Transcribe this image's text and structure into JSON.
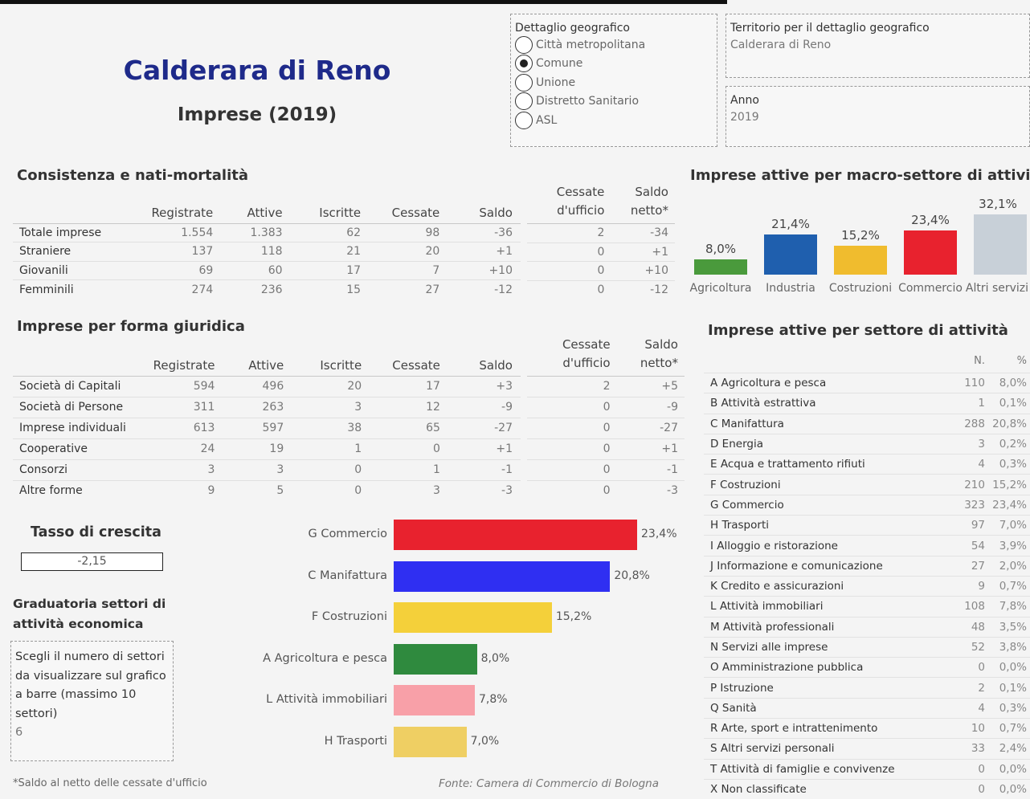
{
  "header": {
    "title": "Calderara di Reno",
    "subtitle": "Imprese  (2019)"
  },
  "geo_filter": {
    "label": "Dettaglio geografico",
    "options": [
      {
        "label": "Città metropolitana",
        "selected": false
      },
      {
        "label": "Comune",
        "selected": true
      },
      {
        "label": "Unione",
        "selected": false
      },
      {
        "label": "Distretto Sanitario",
        "selected": false
      },
      {
        "label": "ASL",
        "selected": false
      }
    ]
  },
  "territorio": {
    "label": "Territorio per il dettaglio geografico",
    "value": "Calderara di Reno"
  },
  "anno": {
    "label": "Anno",
    "value": "2019"
  },
  "consistenza": {
    "title": "Consistenza e nati-mortalità",
    "columns": [
      "",
      "Registrate",
      "Attive",
      "Iscritte",
      "Cessate",
      "Saldo"
    ],
    "rows": [
      [
        "Totale imprese",
        "1.554",
        "1.383",
        "62",
        "98",
        "-36"
      ],
      [
        "Straniere",
        "137",
        "118",
        "21",
        "20",
        "+1"
      ],
      [
        "Giovanili",
        "69",
        "60",
        "17",
        "7",
        "+10"
      ],
      [
        "Femminili",
        "274",
        "236",
        "15",
        "27",
        "-12"
      ]
    ],
    "extra_columns": [
      "Cessate d'ufficio",
      "Saldo netto*"
    ],
    "extra_rows": [
      [
        "2",
        "-34"
      ],
      [
        "0",
        "+1"
      ],
      [
        "0",
        "+10"
      ],
      [
        "0",
        "-12"
      ]
    ]
  },
  "forma": {
    "title": "Imprese per forma giuridica",
    "columns": [
      "",
      "Registrate",
      "Attive",
      "Iscritte",
      "Cessate",
      "Saldo"
    ],
    "rows": [
      [
        "Società di Capitali",
        "594",
        "496",
        "20",
        "17",
        "+3"
      ],
      [
        "Società di Persone",
        "311",
        "263",
        "3",
        "12",
        "-9"
      ],
      [
        "Imprese individuali",
        "613",
        "597",
        "38",
        "65",
        "-27"
      ],
      [
        "Cooperative",
        "24",
        "19",
        "1",
        "0",
        "+1"
      ],
      [
        "Consorzi",
        "3",
        "3",
        "0",
        "1",
        "-1"
      ],
      [
        "Altre forme",
        "9",
        "5",
        "0",
        "3",
        "-3"
      ]
    ],
    "extra_columns": [
      "Cessate d'ufficio",
      "Saldo netto*"
    ],
    "extra_rows": [
      [
        "2",
        "+5"
      ],
      [
        "0",
        "-9"
      ],
      [
        "0",
        "-27"
      ],
      [
        "0",
        "+1"
      ],
      [
        "0",
        "-1"
      ],
      [
        "0",
        "-3"
      ]
    ]
  },
  "tasso": {
    "title": "Tasso di crescita",
    "value": "-2,15"
  },
  "graduatoria": {
    "title_line1": "Graduatoria settori di",
    "title_line2": "attività economica",
    "control_text": "Scegli il numero di settori da visualizzare sul grafico a barre (massimo 10 settori)",
    "control_value": "6"
  },
  "footnote": "*Saldo al netto delle cessate d'ufficio",
  "source": "Fonte: Camera di Commercio di Bologna",
  "macro": {
    "title": "Imprese attive per macro-settore di attività"
  },
  "settore": {
    "title": "Imprese attive per settore di attività",
    "columns": [
      "",
      "N.",
      "%"
    ],
    "rows": [
      [
        "A Agricoltura e pesca",
        "110",
        "8,0%"
      ],
      [
        "B Attività estrattiva",
        "1",
        "0,1%"
      ],
      [
        "C Manifattura",
        "288",
        "20,8%"
      ],
      [
        "D Energia",
        "3",
        "0,2%"
      ],
      [
        "E Acqua e trattamento rifiuti",
        "4",
        "0,3%"
      ],
      [
        "F Costruzioni",
        "210",
        "15,2%"
      ],
      [
        "G Commercio",
        "323",
        "23,4%"
      ],
      [
        "H Trasporti",
        "97",
        "7,0%"
      ],
      [
        "I Alloggio e ristorazione",
        "54",
        "3,9%"
      ],
      [
        "J Informazione e comunicazione",
        "27",
        "2,0%"
      ],
      [
        "K Credito e assicurazioni",
        "9",
        "0,7%"
      ],
      [
        "L Attività immobiliari",
        "108",
        "7,8%"
      ],
      [
        "M Attività professionali",
        "48",
        "3,5%"
      ],
      [
        "N Servizi alle imprese",
        "52",
        "3,8%"
      ],
      [
        "O Amministrazione pubblica",
        "0",
        "0,0%"
      ],
      [
        "P Istruzione",
        "2",
        "0,1%"
      ],
      [
        "Q Sanità",
        "4",
        "0,3%"
      ],
      [
        "R Arte, sport e intrattenimento",
        "10",
        "0,7%"
      ],
      [
        "S Altri servizi personali",
        "33",
        "2,4%"
      ],
      [
        "T Attività di famiglie e convivenze",
        "0",
        "0,0%"
      ],
      [
        "X Non classificate",
        "0",
        "0,0%"
      ]
    ]
  },
  "chart_data": [
    {
      "type": "bar",
      "categories": [
        "Agricoltura",
        "Industria",
        "Costruzioni",
        "Commercio",
        "Altri servizi"
      ],
      "values": [
        8.0,
        21.4,
        15.2,
        23.4,
        32.1
      ],
      "value_labels": [
        "8,0%",
        "21,4%",
        "15,2%",
        "23,4%",
        "32,1%"
      ],
      "colors": [
        "#4a9a3c",
        "#1f5fae",
        "#f0bc2e",
        "#e8222e",
        "#c8d0d8"
      ],
      "title": "Imprese attive per macro-settore di attività"
    },
    {
      "type": "bar",
      "orientation": "horizontal",
      "categories": [
        "G Commercio",
        "C Manifattura",
        "F Costruzioni",
        "A Agricoltura e pesca",
        "L Attività immobiliari",
        "H Trasporti"
      ],
      "values": [
        23.4,
        20.8,
        15.2,
        8.0,
        7.8,
        7.0
      ],
      "value_labels": [
        "23,4%",
        "20,8%",
        "15,2%",
        "8,0%",
        "7,8%",
        "7,0%"
      ],
      "colors": [
        "#e8222e",
        "#2f2ff2",
        "#f4d03a",
        "#2f8a3e",
        "#f8a0a8",
        "#efcf63"
      ]
    }
  ]
}
